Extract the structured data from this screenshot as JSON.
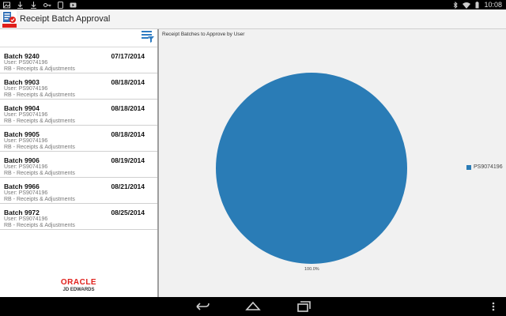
{
  "status_bar": {
    "time": "10:08",
    "left_icons": [
      "gallery-icon",
      "download-icon",
      "download-icon",
      "key-icon",
      "phone-icon",
      "youtube-icon"
    ],
    "right_icons": [
      "bluetooth-icon",
      "wifi-icon",
      "battery-icon"
    ]
  },
  "app_bar": {
    "title": "Receipt Batch Approval"
  },
  "batches": [
    {
      "title": "Batch 9240",
      "date": "07/17/2014",
      "user": "User: PS9074196",
      "type": "RB - Receipts & Adjustments"
    },
    {
      "title": "Batch 9903",
      "date": "08/18/2014",
      "user": "User: PS9074196",
      "type": "RB - Receipts & Adjustments"
    },
    {
      "title": "Batch 9904",
      "date": "08/18/2014",
      "user": "User: PS9074196",
      "type": "RB - Receipts & Adjustments"
    },
    {
      "title": "Batch 9905",
      "date": "08/18/2014",
      "user": "User: PS9074196",
      "type": "RB - Receipts & Adjustments"
    },
    {
      "title": "Batch 9906",
      "date": "08/19/2014",
      "user": "User: PS9074196",
      "type": "RB - Receipts & Adjustments"
    },
    {
      "title": "Batch 9966",
      "date": "08/21/2014",
      "user": "User: PS9074196",
      "type": "RB - Receipts & Adjustments"
    },
    {
      "title": "Batch 9972",
      "date": "08/25/2014",
      "user": "User: PS9074196",
      "type": "RB - Receipts & Adjustments"
    }
  ],
  "branding": {
    "oracle": "ORACLE",
    "product": "JD EDWARDS"
  },
  "colors": {
    "pie_blue": "#2a7cb6",
    "brand_red": "#e0201b"
  },
  "chart_data": {
    "type": "pie",
    "title": "Receipt Batches to Approve by User",
    "categories": [
      "PS9074196"
    ],
    "values": [
      100.0
    ],
    "labels": [
      "100.0%"
    ],
    "legend_position": "right"
  }
}
